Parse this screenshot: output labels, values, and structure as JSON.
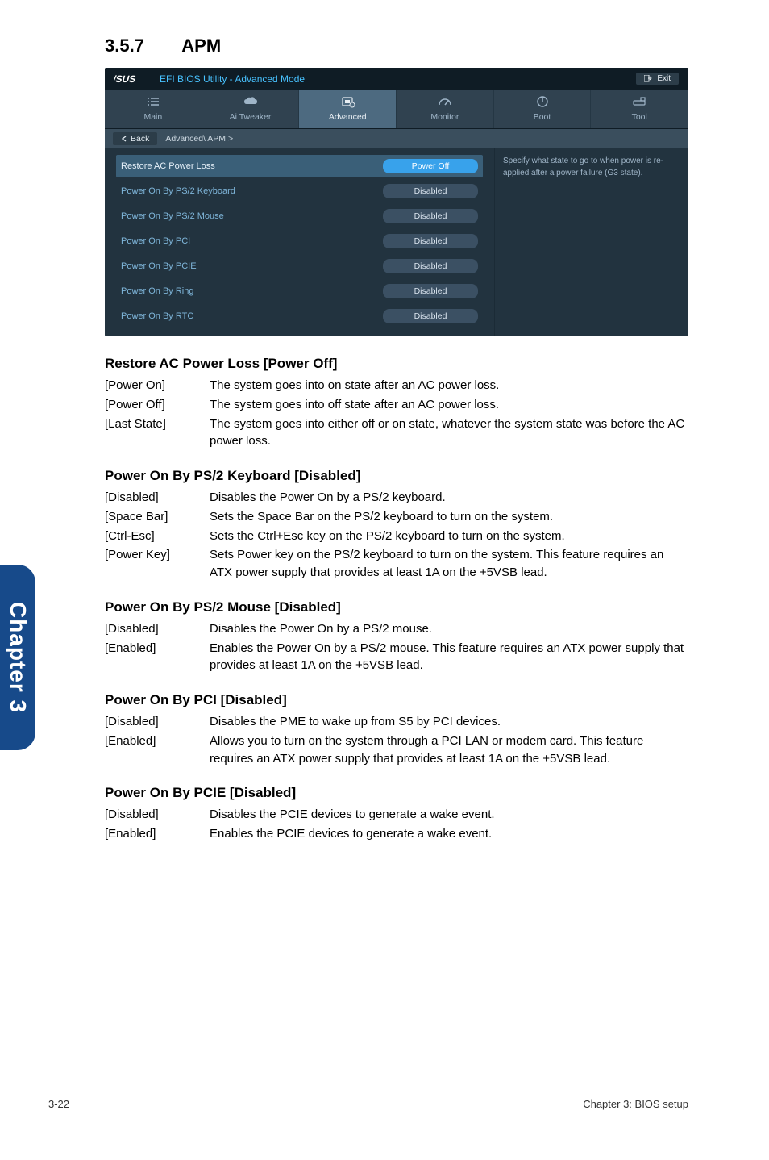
{
  "sidebar_label": "Chapter 3",
  "section": {
    "number": "3.5.7",
    "title": "APM"
  },
  "bios": {
    "brand_title": "EFI BIOS Utility - Advanced Mode",
    "exit_label": "Exit",
    "tabs": {
      "main": "Main",
      "ai_tweaker": "Ai  Tweaker",
      "advanced": "Advanced",
      "monitor": "Monitor",
      "boot": "Boot",
      "tool": "Tool"
    },
    "breadcrumb": {
      "back": "Back",
      "path": "Advanced\\ APM >"
    },
    "help_text": "Specify what state to go to when power is re-applied after a power failure (G3 state).",
    "items": [
      {
        "label": "Restore AC Power Loss",
        "value": "Power Off",
        "highlight": true
      },
      {
        "label": "Power On By PS/2 Keyboard",
        "value": "Disabled"
      },
      {
        "label": "Power On By PS/2 Mouse",
        "value": "Disabled"
      },
      {
        "label": "Power On By PCI",
        "value": "Disabled"
      },
      {
        "label": "Power On By PCIE",
        "value": "Disabled"
      },
      {
        "label": "Power On By Ring",
        "value": "Disabled"
      },
      {
        "label": "Power On By RTC",
        "value": "Disabled"
      }
    ]
  },
  "sections": [
    {
      "heading": "Restore AC Power Loss [Power Off]",
      "rows": [
        {
          "key": "[Power On]",
          "desc": "The system goes into on state after an AC power loss."
        },
        {
          "key": "[Power Off]",
          "desc": "The system goes into off state after an AC power loss."
        },
        {
          "key": "[Last State]",
          "desc": "The system goes into either off or on state, whatever the system state was before the AC power loss."
        }
      ]
    },
    {
      "heading": "Power On By PS/2 Keyboard [Disabled]",
      "rows": [
        {
          "key": "[Disabled]",
          "desc": "Disables the Power On by a PS/2 keyboard."
        },
        {
          "key": "[Space Bar]",
          "desc": "Sets the Space Bar on the PS/2 keyboard to turn on the system."
        },
        {
          "key": "[Ctrl-Esc]",
          "desc": "Sets the Ctrl+Esc key on the PS/2 keyboard to turn on the system."
        },
        {
          "key": "[Power Key]",
          "desc": "Sets Power key on the PS/2 keyboard to turn on the system. This feature requires an ATX power supply that provides at least 1A on the +5VSB lead."
        }
      ]
    },
    {
      "heading": "Power On By PS/2 Mouse [Disabled]",
      "rows": [
        {
          "key": "[Disabled]",
          "desc": "Disables the Power On by a PS/2 mouse."
        },
        {
          "key": "[Enabled]",
          "desc": "Enables the Power On by a PS/2 mouse. This feature requires an ATX power supply that provides at least 1A on the +5VSB lead."
        }
      ]
    },
    {
      "heading": "Power On By PCI [Disabled]",
      "rows": [
        {
          "key": "[Disabled]",
          "desc": "Disables the PME to wake up from S5 by PCI devices."
        },
        {
          "key": "[Enabled]",
          "desc": "Allows you to turn on the system through a PCI LAN or modem card. This feature requires an ATX power supply that provides at least 1A on the +5VSB lead."
        }
      ]
    },
    {
      "heading": "Power On By PCIE [Disabled]",
      "rows": [
        {
          "key": "[Disabled]",
          "desc": "Disables the PCIE devices to generate a wake event."
        },
        {
          "key": "[Enabled]",
          "desc": "Enables the PCIE devices to generate a wake event."
        }
      ]
    }
  ],
  "footer": {
    "left": "3-22",
    "right": "Chapter 3: BIOS setup"
  }
}
